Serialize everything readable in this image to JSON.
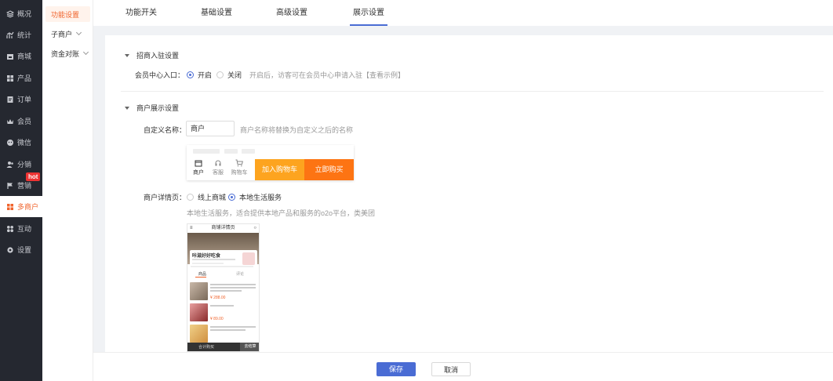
{
  "sidebar": {
    "items": [
      {
        "label": "概况",
        "icon": "layers-icon"
      },
      {
        "label": "统计",
        "icon": "chart-icon"
      },
      {
        "label": "商城",
        "icon": "shop-icon"
      },
      {
        "label": "产品",
        "icon": "grid-icon"
      },
      {
        "label": "订单",
        "icon": "order-icon"
      },
      {
        "label": "会员",
        "icon": "crown-icon"
      },
      {
        "label": "微信",
        "icon": "wechat-icon"
      },
      {
        "label": "分销",
        "icon": "users-icon"
      },
      {
        "label": "营销",
        "icon": "flag-icon"
      },
      {
        "label": "多商户",
        "icon": "merchant-icon"
      },
      {
        "label": "互动",
        "icon": "apps-icon"
      },
      {
        "label": "设置",
        "icon": "gear-icon"
      }
    ],
    "hot_badge": "hot",
    "active_color": "#f0642d"
  },
  "subnav": {
    "items": [
      {
        "label": "功能设置"
      },
      {
        "label": "子商户"
      },
      {
        "label": "资金对账"
      }
    ]
  },
  "tabs": [
    {
      "label": "功能开关"
    },
    {
      "label": "基础设置"
    },
    {
      "label": "高级设置"
    },
    {
      "label": "展示设置"
    }
  ],
  "section1": {
    "title": "招商入驻设置",
    "entry_label": "会员中心入口：",
    "option_on": "开启",
    "option_off": "关闭",
    "hint": "开启后，访客可在会员中心申请入驻【查看示例】"
  },
  "section2": {
    "title": "商户展示设置",
    "name_label": "自定义名称：",
    "name_value": "商户",
    "name_hint": "商户名称将替换为自定义之后的名称",
    "preview": {
      "icon1": "商户",
      "icon2": "客服",
      "icon3": "购物车",
      "add_cart": "加入购物车",
      "buy_now": "立即购买"
    },
    "detail_label": "商户详情页：",
    "detail_opt1": "线上商城",
    "detail_opt2": "本地生活服务",
    "detail_hint": "本地生活服务，适合提供本地产品和服务的o2o平台，类美团",
    "phone": {
      "title": "商铺详情页",
      "shop_name": "咔滋好好吃食",
      "tab1": "商品",
      "tab2": "评论",
      "price1": "¥ 288.00",
      "price2": "¥ 89.00",
      "bottom_cart": "合计购买",
      "bottom_btn": "去结算"
    }
  },
  "footer": {
    "save": "保存",
    "cancel": "取消"
  },
  "colors": {
    "primary": "#4a6cd4",
    "orange": "#f0642d",
    "add_cart": "#fda41f",
    "buy_now": "#fd7413"
  }
}
